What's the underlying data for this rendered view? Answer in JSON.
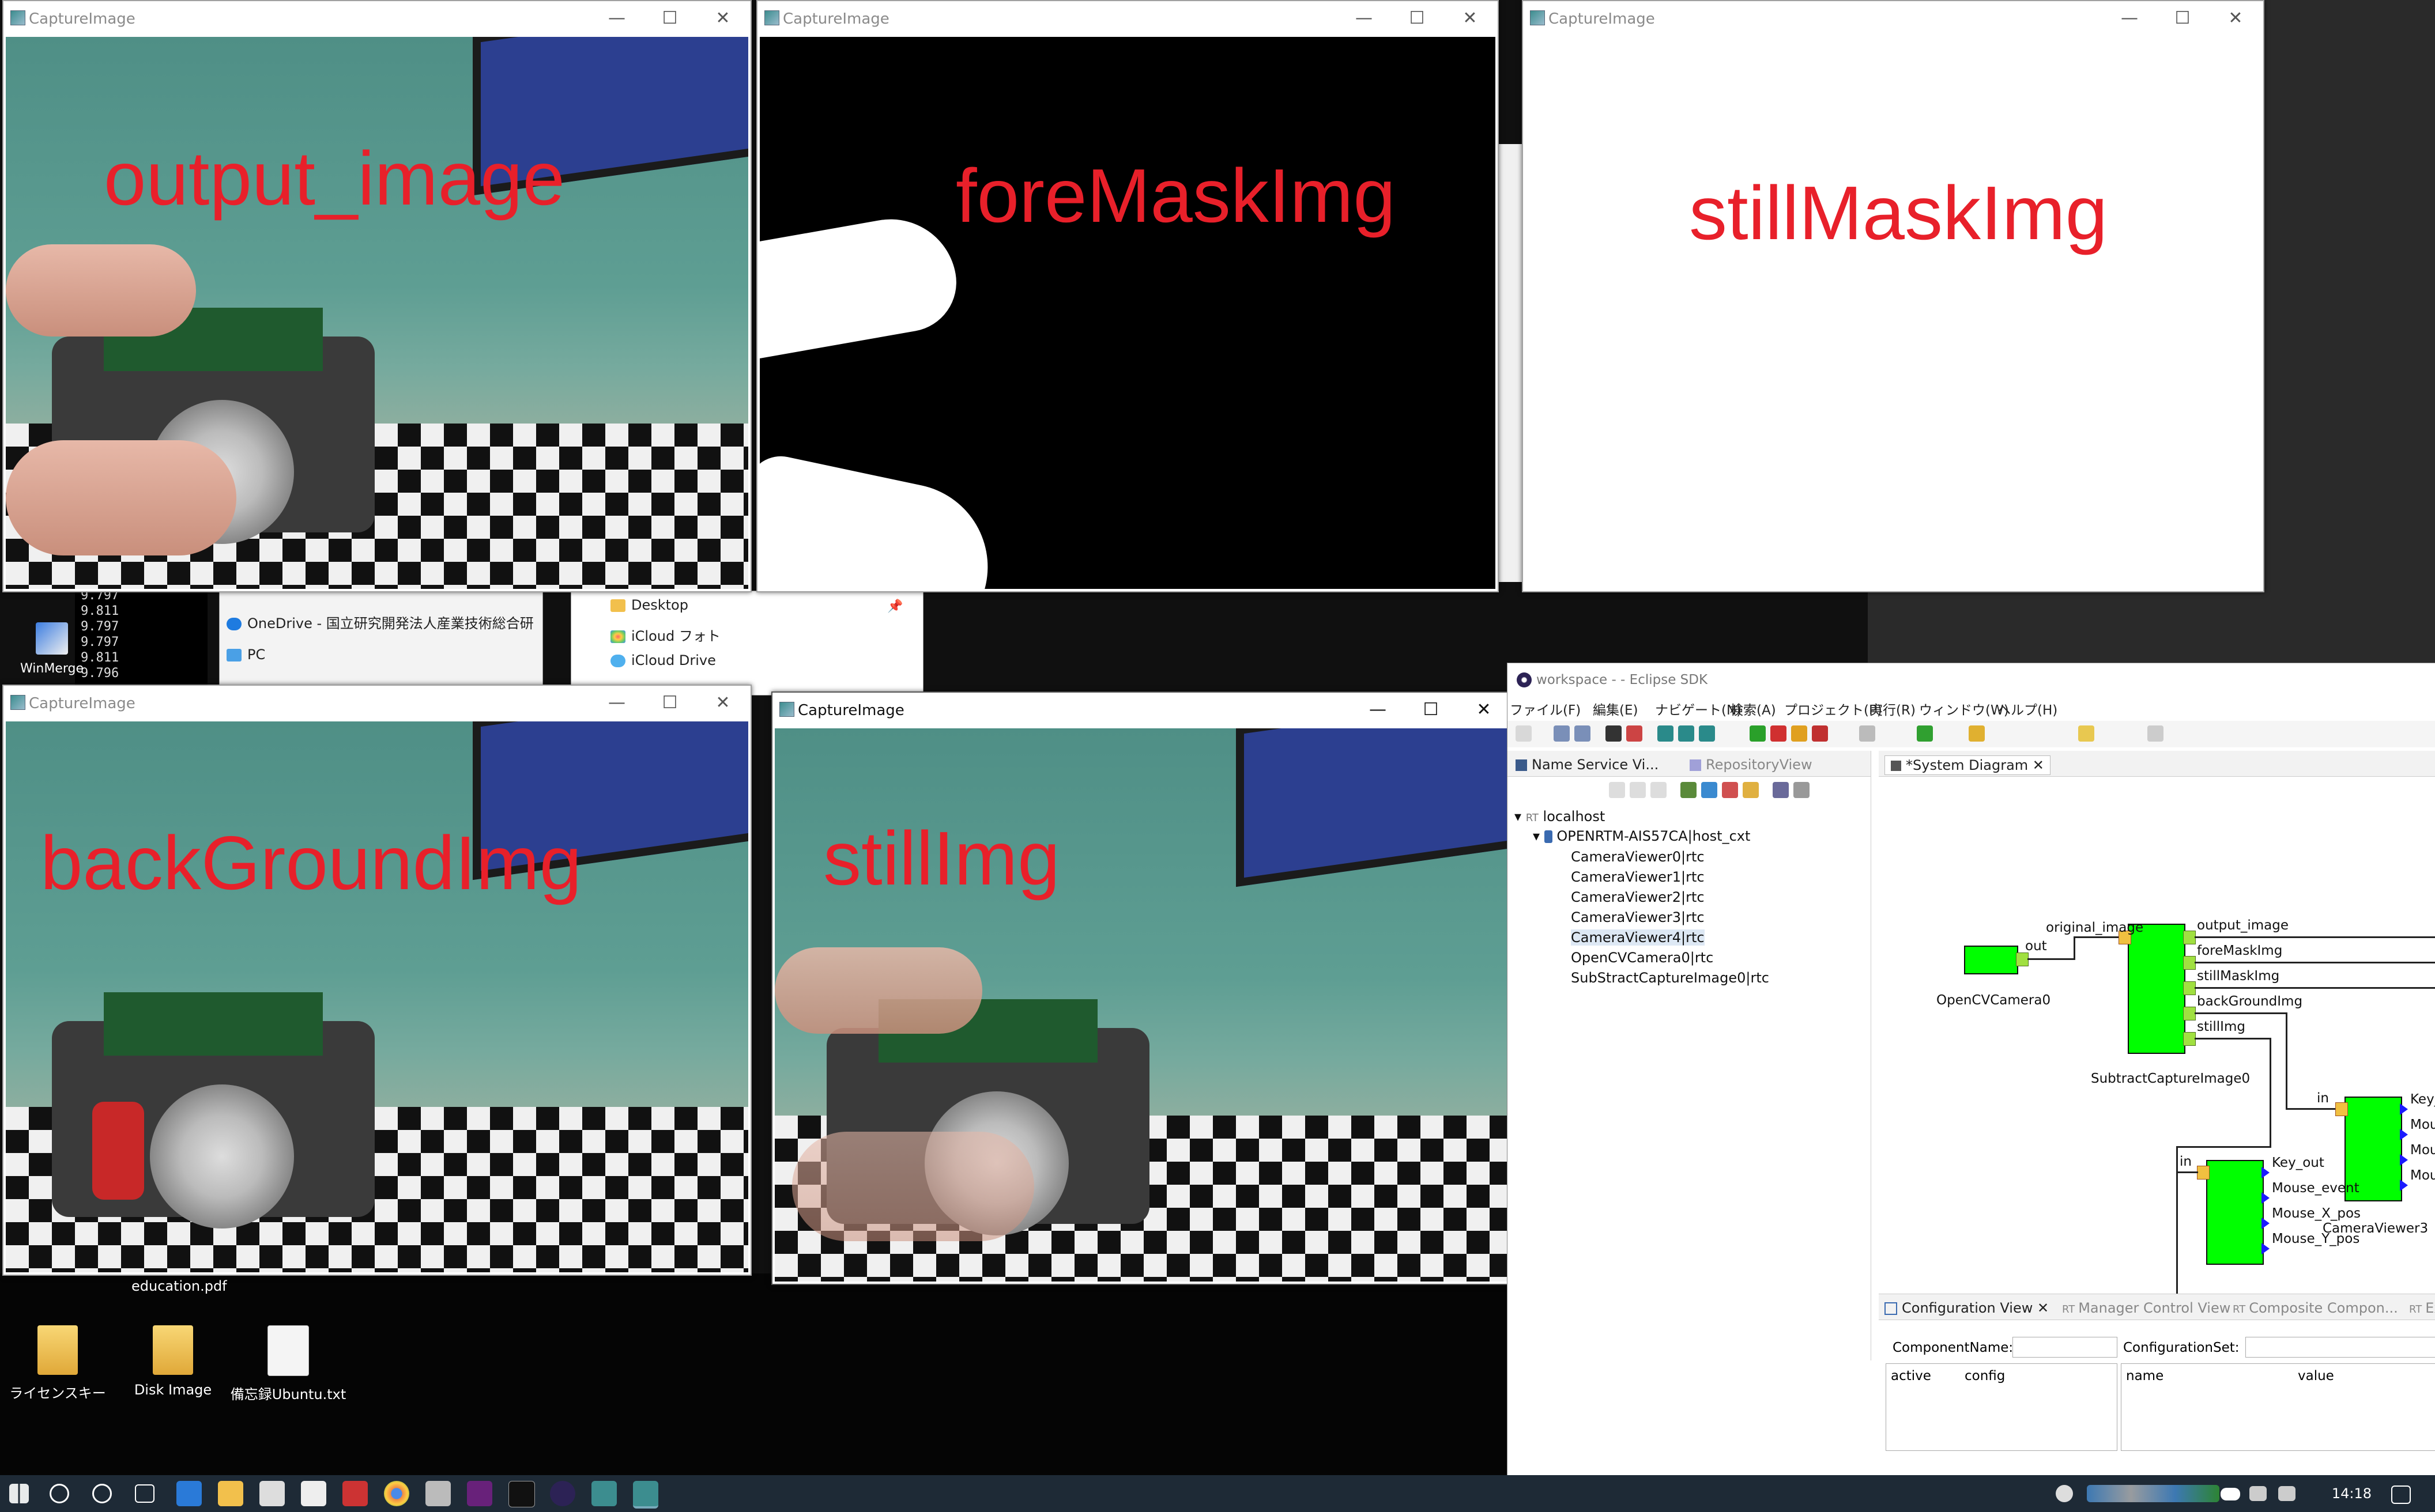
{
  "capture_windows": [
    {
      "title": "CaptureImage",
      "overlay": "output_image"
    },
    {
      "title": "CaptureImage",
      "overlay": "foreMaskImg"
    },
    {
      "title": "CaptureImage",
      "overlay": "stillMaskImg"
    },
    {
      "title": "CaptureImage",
      "overlay": "backGroundImg"
    },
    {
      "title": "CaptureImage",
      "overlay": "stillImg"
    }
  ],
  "window_controls": {
    "minimize": "—",
    "maximize": "☐",
    "close": "✕"
  },
  "explorer": {
    "onedrive": "OneDrive - 国立研究開発法人産業技術総合研",
    "pc": "PC",
    "quick": [
      "Desktop",
      "iCloud フォト",
      "iCloud Drive"
    ]
  },
  "desktop": {
    "winmerge": "WinMerge",
    "terminal_lines": [
      "9.797",
      "9.811",
      "9.797",
      "9.797",
      "9.811",
      "9.796"
    ],
    "education": "education.pdf",
    "icons": [
      "ライセンスキー",
      "Disk Image",
      "備忘録Ubuntu.txt"
    ]
  },
  "eclipse": {
    "title": "workspace -  - Eclipse SDK",
    "menu": [
      "ファイル(F)",
      "編集(E)",
      "ナビゲート(N)",
      "検索(A)",
      "プロジェクト(P)",
      "実行(R)",
      "ウィンドウ(W)",
      "ヘルプ(H)"
    ],
    "tabs": {
      "name_service": "Name Service Vi...",
      "repository": "RepositoryView",
      "system_diagram": "*System Diagram"
    },
    "tree": {
      "root": "localhost",
      "host": "OPENRTM-AIS57CA|host_cxt",
      "items": [
        "CameraViewer0|rtc",
        "CameraViewer1|rtc",
        "CameraViewer2|rtc",
        "CameraViewer3|rtc",
        "CameraViewer4|rtc",
        "OpenCVCamera0|rtc",
        "SubStractCaptureImage0|rtc"
      ]
    },
    "diagram": {
      "camera": {
        "name": "OpenCVCamera0",
        "port": "out"
      },
      "subtract": {
        "name": "SubtractCaptureImage0",
        "in_port": "original_image",
        "out_ports": [
          "output_image",
          "foreMaskImg",
          "stillMaskImg",
          "backGroundImg",
          "stillImg"
        ]
      },
      "viewer3": {
        "name": "CameraViewer3",
        "in_port": "in",
        "out_ports": [
          "Key_o",
          "Mous",
          "Mous",
          "Mous"
        ]
      },
      "viewer4": {
        "in_port": "in",
        "out_ports": [
          "Key_out",
          "Mouse_event",
          "Mouse_X_pos",
          "Mouse_Y_pos"
        ]
      }
    },
    "bottom_tabs": {
      "config": "Configuration View",
      "manager": "Manager Control View",
      "composite": "Composite Compon...",
      "extra": "Ex"
    },
    "config": {
      "component_name_label": "ComponentName:",
      "configuration_set_label": "ConfigurationSet:",
      "col_active": "active",
      "col_config": "config",
      "col_name": "name",
      "col_value": "value"
    }
  },
  "taskbar": {
    "clock": "14:18"
  },
  "colors": {
    "overlay_red": "#e8202a",
    "port_green": "#00ff00",
    "outport_blue": "#1a1aff"
  }
}
